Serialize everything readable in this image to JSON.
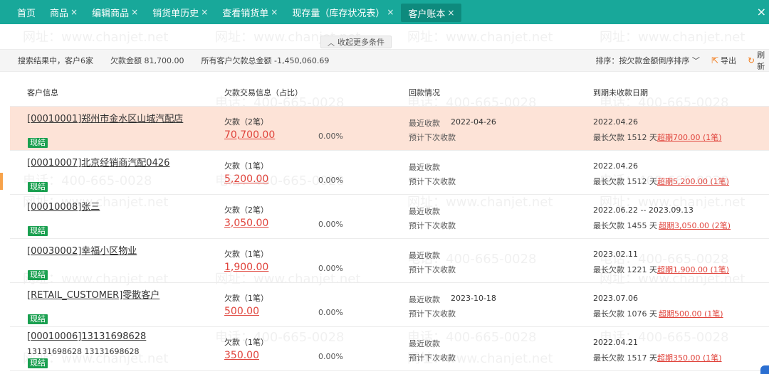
{
  "tabs": [
    {
      "label": "首页",
      "closable": false
    },
    {
      "label": "商品",
      "closable": true
    },
    {
      "label": "编辑商品",
      "closable": true
    },
    {
      "label": "销货单历史",
      "closable": true
    },
    {
      "label": "查看销货单",
      "closable": true
    },
    {
      "label": "现存量（库存状况表）",
      "closable": true
    },
    {
      "label": "客户账本",
      "closable": true,
      "active": true
    }
  ],
  "tab_close_glyph": "×",
  "collapse_label": "收起更多条件",
  "summary": {
    "result": "搜索结果中，客户6家",
    "debt": "欠款金额 81,700.00",
    "total": "所有客户欠款总金额 -1,450,060.69",
    "sort": "排序：按欠款金额倒序排序",
    "export": "导出",
    "refresh": "刷新"
  },
  "headers": {
    "customer": "客户信息",
    "debt": "欠款交易信息（占比）",
    "payback": "回款情况",
    "due": "到期未收款日期"
  },
  "labels": {
    "recent": "最近收款",
    "next": "预计下次收款",
    "badge": "现结"
  },
  "rows": [
    {
      "name": "[00010001]郑州市金水区山城汽配店",
      "sub": "",
      "count": "欠款（2笔）",
      "amount": "70,700.00",
      "pct": "0.00%",
      "recent_date": "2022-04-26",
      "due": "2022.04.26",
      "longest": "最长欠款 1512 天",
      "overdue": "超期700.00 (1笔)",
      "highlight": true
    },
    {
      "name": "[00010007]北京经销商汽配0426",
      "sub": "",
      "count": "欠款（1笔）",
      "amount": "5,200.00",
      "pct": "0.00%",
      "recent_date": "",
      "due": "2022.04.26",
      "longest": "最长欠款 1512 天",
      "overdue": "超期5,200.00 (1笔)",
      "highlight": false
    },
    {
      "name": "[00010008]张三",
      "sub": "",
      "count": "欠款（2笔）",
      "amount": "3,050.00",
      "pct": "0.00%",
      "recent_date": "",
      "due": "2022.06.22 -- 2023.09.13",
      "longest": "最长欠款 1455 天",
      "overdue": "超期3,050.00 (2笔)",
      "highlight": false
    },
    {
      "name": "[00030002]幸福小区物业",
      "sub": "",
      "count": "欠款（1笔）",
      "amount": "1,900.00",
      "pct": "0.00%",
      "recent_date": "",
      "due": "2023.02.11",
      "longest": "最长欠款 1221 天",
      "overdue": "超期1,900.00 (1笔)",
      "highlight": false
    },
    {
      "name": "[RETAIL_CUSTOMER]零散客户",
      "sub": "",
      "count": "欠款（1笔）",
      "amount": "500.00",
      "pct": "0.00%",
      "recent_date": "2023-10-18",
      "due": "2023.07.06",
      "longest": "最长欠款 1076 天",
      "overdue": "超期500.00 (1笔)",
      "highlight": false
    },
    {
      "name": "[00010006]13131698628",
      "sub": "13131698628  13131698628",
      "count": "欠款（1笔）",
      "amount": "350.00",
      "pct": "0.00%",
      "recent_date": "",
      "due": "2022.04.21",
      "longest": "最长欠款 1517 天",
      "overdue": "超期350.00 (1笔)",
      "highlight": false
    }
  ],
  "watermark": {
    "site": "网址：www.chanjet.net",
    "phone": "电话：400-665-0028"
  },
  "colors": {
    "tabbar": "#18a89a",
    "accent": "#f27b1a",
    "debt": "#e0443c",
    "badge": "#1aa050",
    "highlight": "#fde3d7"
  }
}
